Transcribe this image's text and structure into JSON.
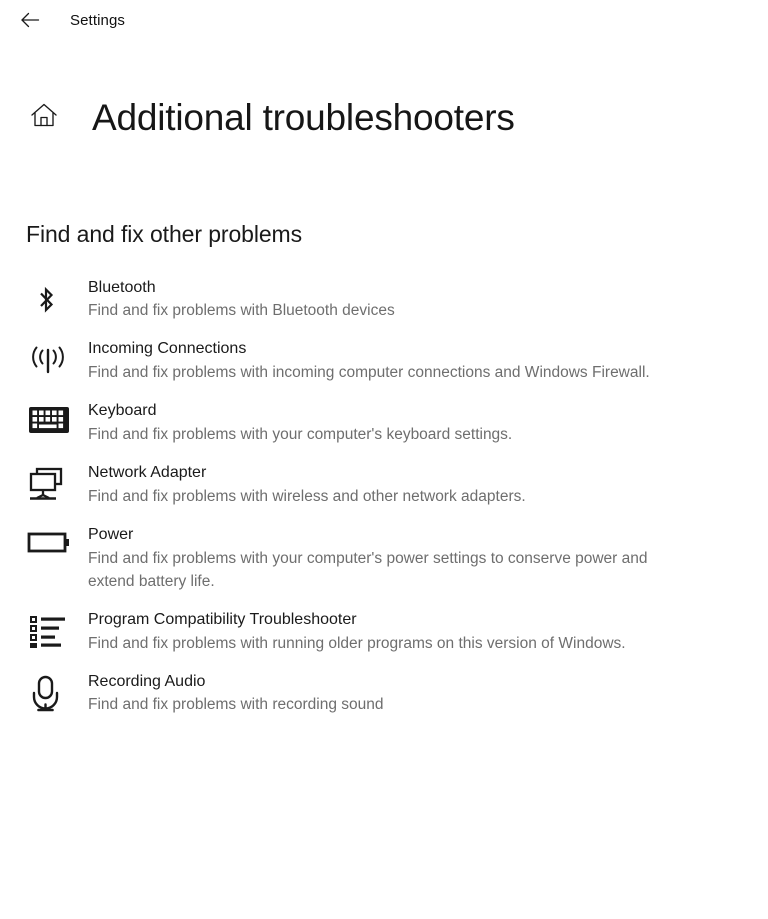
{
  "titlebar": {
    "back_icon": "back-arrow-icon",
    "app_name": "Settings"
  },
  "header": {
    "home_icon": "home-icon",
    "title": "Additional troubleshooters"
  },
  "section": {
    "heading": "Find and fix other problems"
  },
  "troubleshooters": [
    {
      "icon": "bluetooth-icon",
      "title": "Bluetooth",
      "description": "Find and fix problems with Bluetooth devices"
    },
    {
      "icon": "incoming-connections-icon",
      "title": "Incoming Connections",
      "description": "Find and fix problems with incoming computer connections and Windows Firewall."
    },
    {
      "icon": "keyboard-icon",
      "title": "Keyboard",
      "description": "Find and fix problems with your computer's keyboard settings."
    },
    {
      "icon": "network-adapter-icon",
      "title": "Network Adapter",
      "description": "Find and fix problems with wireless and other network adapters."
    },
    {
      "icon": "battery-icon",
      "title": "Power",
      "description": "Find and fix problems with your computer's power settings to conserve power and extend battery life."
    },
    {
      "icon": "list-icon",
      "title": "Program Compatibility Troubleshooter",
      "description": "Find and fix problems with running older programs on this version of Windows."
    },
    {
      "icon": "microphone-icon",
      "title": "Recording Audio",
      "description": "Find and fix problems with recording sound"
    }
  ],
  "colors": {
    "background": "#ffffff",
    "title_text": "#1a1a1a",
    "description_text": "#6e6e6e",
    "icon": "#1a1a1a"
  }
}
